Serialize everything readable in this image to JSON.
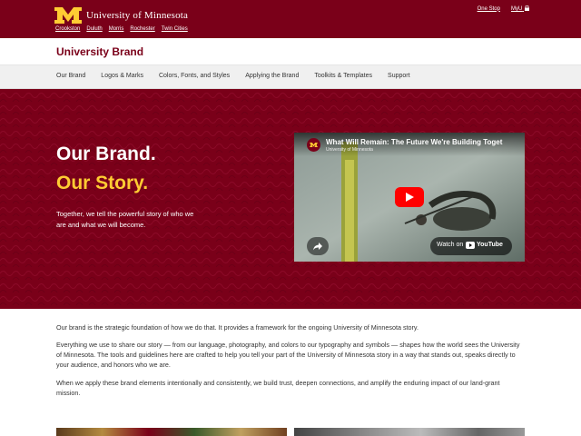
{
  "header": {
    "logo_text": "University of Minnesota",
    "campuses": [
      "Crookston",
      "Duluth",
      "Morris",
      "Rochester",
      "Twin Cities"
    ],
    "one_stop": "One Stop",
    "myu": "MyU"
  },
  "site": {
    "title": "University Brand"
  },
  "nav": {
    "items": [
      "Our Brand",
      "Logos & Marks",
      "Colors, Fonts, and Styles",
      "Applying the Brand",
      "Toolkits & Templates",
      "Support"
    ]
  },
  "hero": {
    "heading_line1": "Our Brand.",
    "heading_line2": "Our Story.",
    "paragraph": "Together, we tell the powerful story of who we are and what we will become."
  },
  "video": {
    "title": "What Will Remain: The Future We're Building Toget",
    "channel": "University of Minnesota",
    "watch_on": "Watch on",
    "youtube": "YouTube",
    "avatar_icon": "block-m-icon",
    "play_icon": "play-icon",
    "share_icon": "share-icon"
  },
  "content": {
    "paragraphs": [
      "Our brand is the strategic foundation of how we do that. It provides a framework for the ongoing University of Minnesota story.",
      "Everything we use to share our story — from our language, photography, and colors to our typography and symbols — shapes how the world sees the University of Minnesota. The tools and guidelines here are crafted to help you tell your part of the University of Minnesota story in a way that stands out, speaks directly to your audience, and honors who we are.",
      "When we apply these brand elements intentionally and consistently, we build trust, deepen connections, and amplify the enduring impact of our land-grant mission."
    ]
  },
  "colors": {
    "maroon": "#7a0019",
    "gold": "#ffcc33",
    "youtube_red": "#ff0000"
  }
}
